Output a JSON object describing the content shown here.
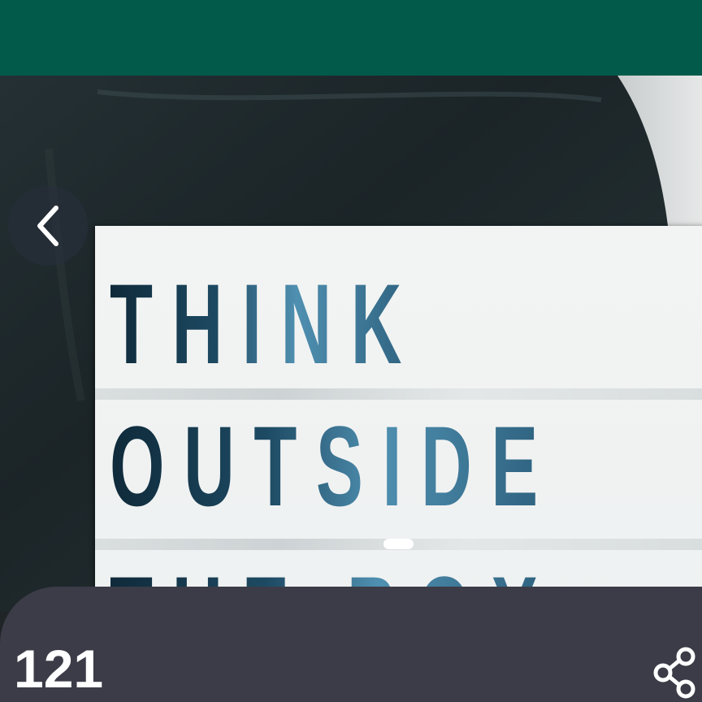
{
  "header": {
    "color": "#025a4b"
  },
  "image": {
    "sign_lines": [
      "THINK",
      "OUTSIDE",
      "THE BOX"
    ]
  },
  "navigation": {
    "back_icon": "chevron-left-icon"
  },
  "pager": {
    "active_indicator": "page-indicator"
  },
  "footer": {
    "count": "121",
    "share_icon": "share-icon",
    "background": "#3b3c47"
  }
}
